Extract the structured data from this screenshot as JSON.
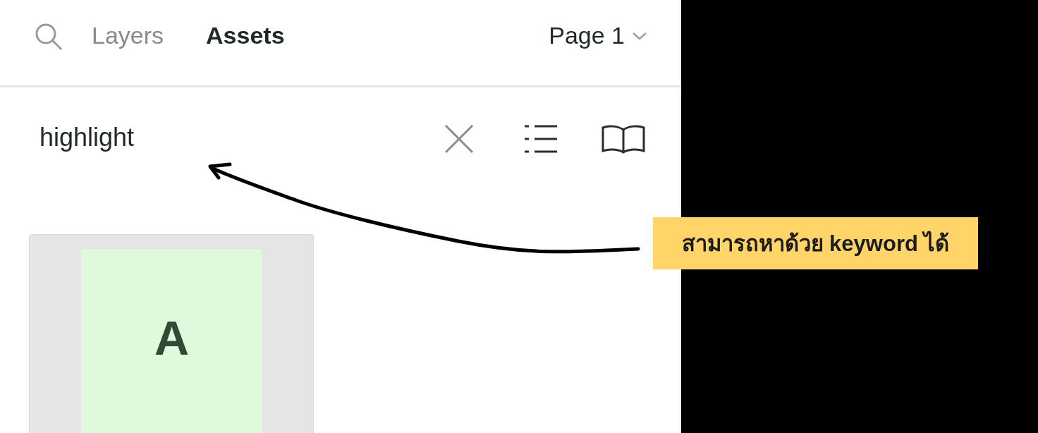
{
  "tabs": [
    {
      "label": "Layers",
      "selected": false
    },
    {
      "label": "Assets",
      "selected": true
    }
  ],
  "page_selector": {
    "label": "Page 1"
  },
  "search": {
    "value": "highlight"
  },
  "assets": [
    {
      "letter": "A"
    }
  ],
  "annotation": {
    "text": "สามารถหาด้วย keyword ได้"
  }
}
